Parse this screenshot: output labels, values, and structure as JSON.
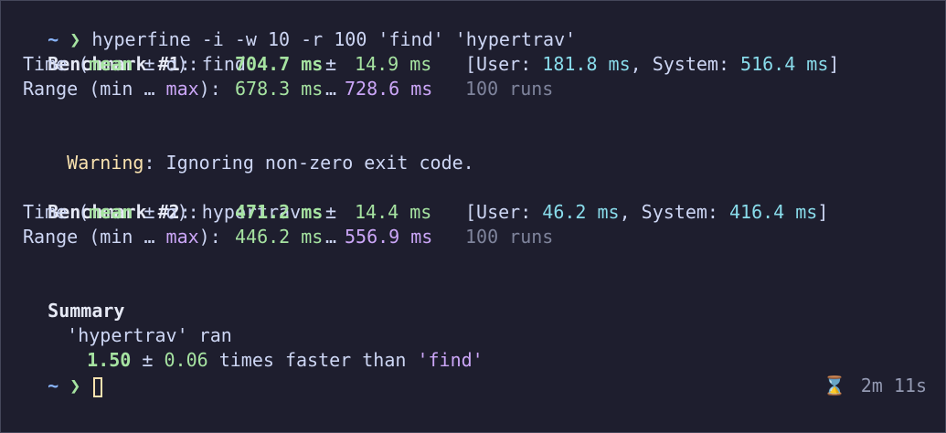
{
  "prompt": {
    "tilde": "~",
    "chevron": "❯",
    "command": "hyperfine -i -w 10 -r 100 'find' 'hypertrav'"
  },
  "benchmarks": [
    {
      "header_label": "Benchmark #1",
      "header_colon": ":",
      "name": "find",
      "time_label_pre": "Time (",
      "time_label_mean": "mean",
      "time_label_post": " ± σ):",
      "mean": "704.7 ms",
      "pm": "±",
      "sigma": "14.9 ms",
      "user_system_open": "[User: ",
      "user": "181.8 ms",
      "system_sep": ", System: ",
      "system": "516.4 ms",
      "user_system_close": "]",
      "range_label_pre": "Range (min … ",
      "range_label_max": "max",
      "range_label_post": "):",
      "range_min": "678.3 ms",
      "range_sep": "…",
      "range_max": "728.6 ms",
      "runs": "100 runs"
    },
    {
      "header_label": "Benchmark #2",
      "header_colon": ":",
      "name": "hypertrav",
      "time_label_pre": "Time (",
      "time_label_mean": "mean",
      "time_label_post": " ± σ):",
      "mean": "471.2 ms",
      "pm": "±",
      "sigma": "14.4 ms",
      "user_system_open": "[User: ",
      "user": "46.2 ms",
      "system_sep": ", System: ",
      "system": "416.4 ms",
      "user_system_close": "]",
      "range_label_pre": "Range (min … ",
      "range_label_max": "max",
      "range_label_post": "):",
      "range_min": "446.2 ms",
      "range_sep": "…",
      "range_max": "556.9 ms",
      "runs": "100 runs"
    }
  ],
  "warning": {
    "label": "Warning",
    "text": ": Ignoring non-zero exit code."
  },
  "summary": {
    "title": "Summary",
    "ran_line": "'hypertrav' ran",
    "factor": "1.50",
    "pm": "±",
    "error": "0.06",
    "text": " times faster than ",
    "quote_open": "'",
    "target": "find",
    "quote_close": "'"
  },
  "status": {
    "hourglass": "⌛",
    "duration": "2m 11s"
  },
  "colors": {
    "background": "#1e1e2e",
    "accent_green": "#a6e3a1",
    "accent_purple": "#cba6f7",
    "accent_blue": "#89dceb",
    "warning": "#f9e2af"
  }
}
